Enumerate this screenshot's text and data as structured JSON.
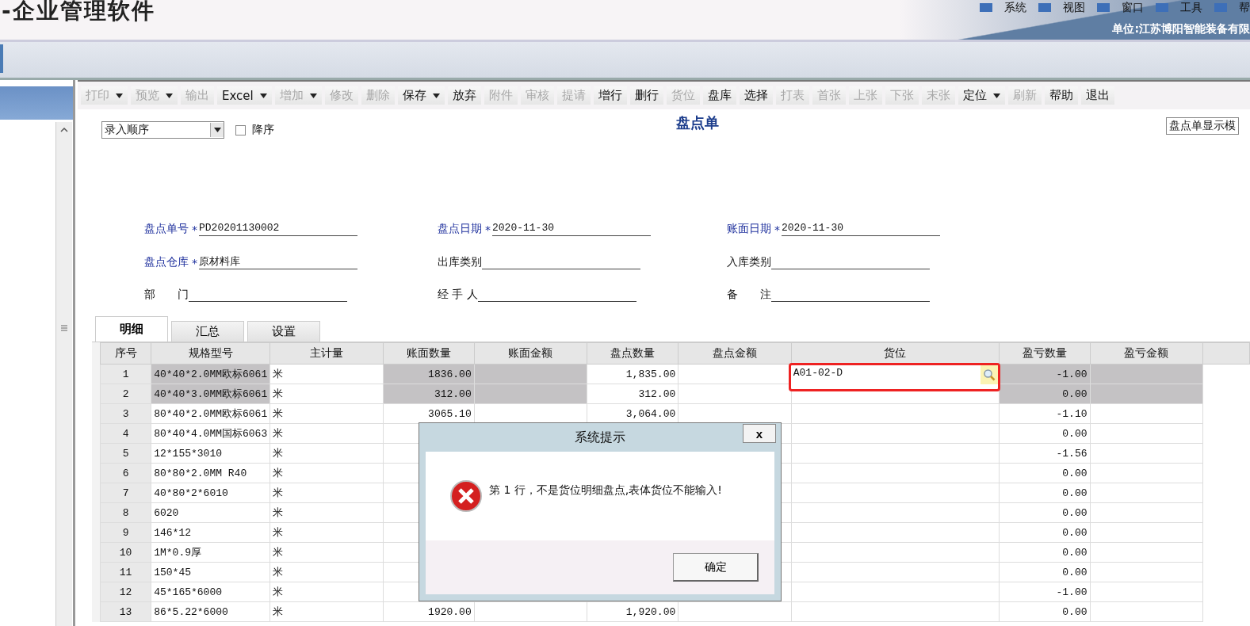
{
  "app": {
    "title": "-企业管理软件",
    "menu": [
      "系统",
      "视图",
      "窗口",
      "工具",
      "帮"
    ],
    "company": "单位:江苏博阳智能装备有限"
  },
  "toolbar": [
    {
      "label": "打印",
      "disabled": true,
      "dropdown": true
    },
    {
      "label": "预览",
      "disabled": true,
      "dropdown": true
    },
    {
      "label": "输出",
      "disabled": true,
      "dropdown": false
    },
    {
      "label": "Excel",
      "disabled": false,
      "dropdown": true
    },
    {
      "label": "增加",
      "disabled": true,
      "dropdown": true
    },
    {
      "label": "修改",
      "disabled": true,
      "dropdown": false
    },
    {
      "label": "删除",
      "disabled": true,
      "dropdown": false
    },
    {
      "label": "保存",
      "disabled": false,
      "dropdown": true
    },
    {
      "label": "放弃",
      "disabled": false,
      "dropdown": false
    },
    {
      "label": "附件",
      "disabled": true,
      "dropdown": false
    },
    {
      "label": "审核",
      "disabled": true,
      "dropdown": false
    },
    {
      "label": "提请",
      "disabled": true,
      "dropdown": false
    },
    {
      "label": "增行",
      "disabled": false,
      "dropdown": false
    },
    {
      "label": "删行",
      "disabled": false,
      "dropdown": false
    },
    {
      "label": "货位",
      "disabled": true,
      "dropdown": false
    },
    {
      "label": "盘库",
      "disabled": false,
      "dropdown": false
    },
    {
      "label": "选择",
      "disabled": false,
      "dropdown": false
    },
    {
      "label": "打表",
      "disabled": true,
      "dropdown": false
    },
    {
      "label": "首张",
      "disabled": true,
      "dropdown": false
    },
    {
      "label": "上张",
      "disabled": true,
      "dropdown": false
    },
    {
      "label": "下张",
      "disabled": true,
      "dropdown": false
    },
    {
      "label": "末张",
      "disabled": true,
      "dropdown": false
    },
    {
      "label": "定位",
      "disabled": false,
      "dropdown": true
    },
    {
      "label": "刷新",
      "disabled": true,
      "dropdown": false
    },
    {
      "label": "帮助",
      "disabled": false,
      "dropdown": false
    },
    {
      "label": "退出",
      "disabled": false,
      "dropdown": false
    }
  ],
  "sort": {
    "value": "录入顺序",
    "descending": {
      "label": "降序",
      "checked": false
    }
  },
  "form_title": "盘点单",
  "template_select": "盘点单显示模",
  "fields": [
    [
      {
        "label": "盘点单号",
        "required": true,
        "mark": "*",
        "value": "PD20201130002"
      },
      {
        "label": "盘点日期",
        "required": true,
        "mark": "*",
        "value": "2020-11-30"
      },
      {
        "label": "账面日期",
        "required": true,
        "mark": "*",
        "value": "2020-11-30"
      }
    ],
    [
      {
        "label": "盘点仓库",
        "required": true,
        "mark": "*",
        "value": "原材料库"
      },
      {
        "label": "出库类别",
        "required": false
      },
      {
        "label": "入库类别",
        "required": false
      }
    ],
    [
      {
        "label": "部　　门",
        "required": false
      },
      {
        "label": "经 手 人",
        "required": false
      },
      {
        "label": "备　　注",
        "required": false
      }
    ]
  ],
  "tabs": [
    {
      "label": "明细",
      "selected": true
    },
    {
      "label": "汇总",
      "selected": false
    },
    {
      "label": "设置",
      "selected": false
    }
  ],
  "table": {
    "columns": [
      "序号",
      "规格型号",
      "主计量",
      "账面数量",
      "账面金额",
      "盘点数量",
      "盘点金额",
      "货位",
      "盈亏数量",
      "盈亏金额"
    ],
    "rows": [
      {
        "no": "1",
        "spec": "40*40*2.0MM欧标6061",
        "unit": "米",
        "book_qty": "1836.00",
        "count_qty": "1,835.00",
        "location": "A01-02-D",
        "editing": true,
        "diff_qty": "-1.00",
        "selected": true
      },
      {
        "no": "2",
        "spec": "40*40*3.0MM欧标6061",
        "unit": "米",
        "book_qty": "312.00",
        "count_qty": "312.00",
        "diff_qty": "0.00",
        "selected": true
      },
      {
        "no": "3",
        "spec": "80*40*2.0MM欧标6061",
        "unit": "米",
        "book_qty": "3065.10",
        "count_qty": "3,064.00",
        "diff_qty": "-1.10",
        "selected": false
      },
      {
        "no": "4",
        "spec": "80*40*4.0MM国标6063",
        "unit": "米",
        "diff_qty": "0.00",
        "selected": false
      },
      {
        "no": "5",
        "spec": "12*155*3010",
        "unit": "米",
        "diff_qty": "-1.56",
        "selected": false
      },
      {
        "no": "6",
        "spec": "80*80*2.0MM R40",
        "unit": "米",
        "diff_qty": "0.00",
        "selected": false
      },
      {
        "no": "7",
        "spec": "40*80*2*6010",
        "unit": "米",
        "diff_qty": "0.00",
        "selected": false
      },
      {
        "no": "8",
        "spec": "6020",
        "unit": "米",
        "diff_qty": "0.00",
        "selected": false
      },
      {
        "no": "9",
        "spec": "146*12",
        "unit": "米",
        "diff_qty": "0.00",
        "selected": false
      },
      {
        "no": "10",
        "spec": "1M*0.9厚",
        "unit": "米",
        "diff_qty": "0.00",
        "selected": false
      },
      {
        "no": "11",
        "spec": "150*45",
        "unit": "米",
        "diff_qty": "0.00",
        "selected": false
      },
      {
        "no": "12",
        "spec": "45*165*6000",
        "unit": "米",
        "diff_qty": "-1.00",
        "selected": false
      },
      {
        "no": "13",
        "spec": "86*5.22*6000",
        "unit": "米",
        "book_qty": "1920.00",
        "count_qty": "1,920.00",
        "diff_qty": "0.00",
        "selected": false
      }
    ]
  },
  "dialog": {
    "title": "系统提示",
    "close": "x",
    "message": "第 1 行，不是货位明细盘点,表体货位不能输入!",
    "button": "确定"
  }
}
